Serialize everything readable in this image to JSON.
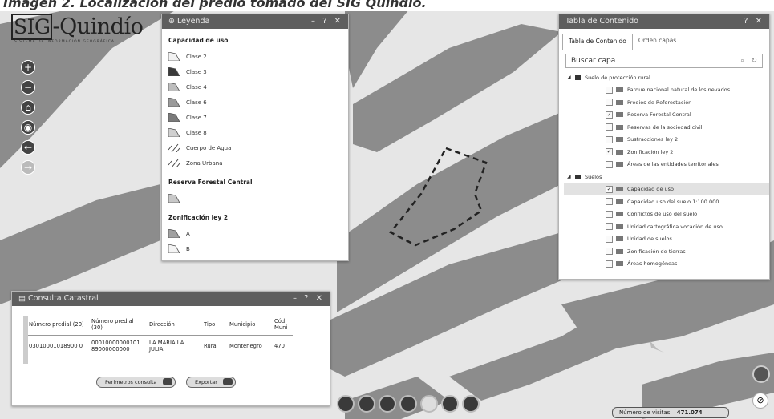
{
  "caption": "Imagen 2. Localización del predio tomado del SIG Quindío.",
  "logo": {
    "title_prefix": "SIG",
    "title_rest": "-Quindío",
    "subtitle": "SISTEMA DE INFORMACIÓN GEOGRÁFICA"
  },
  "map_controls": [
    "+",
    "−",
    "⌂",
    "◉",
    "←",
    "→"
  ],
  "legend": {
    "title": "Leyenda",
    "controls": "– ? ✕",
    "sections": [
      {
        "title": "Capacidad de uso",
        "items": [
          "Clase 2",
          "Clase 3",
          "Clase 4",
          "Clase 6",
          "Clase 7",
          "Clase 8",
          "Cuerpo de Agua",
          "Zona Urbana"
        ]
      },
      {
        "title": "Reserva Forestal Central",
        "items": [
          ""
        ]
      },
      {
        "title": "Zonificación ley 2",
        "items": [
          "A",
          "B"
        ]
      }
    ]
  },
  "toc": {
    "title": "Tabla de Contenido",
    "controls": "? ✕",
    "tabs": [
      "Tabla de Contenido",
      "Orden capas"
    ],
    "search_placeholder": "Buscar capa",
    "groups": [
      {
        "name": "Suelo de protección rural",
        "layers": [
          {
            "name": "Parque nacional natural de los nevados",
            "checked": false
          },
          {
            "name": "Predios de Reforestación",
            "checked": false
          },
          {
            "name": "Reserva Forestal Central",
            "checked": true
          },
          {
            "name": "Reservas de la sociedad civil",
            "checked": false
          },
          {
            "name": "Sustracciones ley 2",
            "checked": false
          },
          {
            "name": "Zonificación ley 2",
            "checked": true
          },
          {
            "name": "Áreas de las entidades territoriales",
            "checked": false
          }
        ]
      },
      {
        "name": "Suelos",
        "layers": [
          {
            "name": "Capacidad de uso",
            "checked": true,
            "selected": true
          },
          {
            "name": "Capacidad uso del suelo 1:100.000",
            "checked": false
          },
          {
            "name": "Conflictos de uso del suelo",
            "checked": false
          },
          {
            "name": "Unidad cartográfica vocación de uso",
            "checked": false
          },
          {
            "name": "Unidad de suelos",
            "checked": false
          },
          {
            "name": "Zonificación de tierras",
            "checked": false
          },
          {
            "name": "Áreas homogéneas",
            "checked": false
          }
        ]
      }
    ]
  },
  "consulta": {
    "title": "Consulta Catastral",
    "controls": "– ? ✕",
    "columns": [
      "Número predial (20)",
      "Número predial (30)",
      "Dirección",
      "Tipo",
      "Municipio",
      "Cód. Muni"
    ],
    "rows": [
      [
        "03010001018900 0",
        "00010000000101 89000000000",
        "LA MARIA LA JULIA",
        "Rural",
        "Montenegro",
        "470"
      ]
    ],
    "btn_perimetros": "Perímetros consulta",
    "btn_exportar": "Exportar"
  },
  "visits": {
    "label": "Número de visitas:",
    "value": "471.074"
  }
}
